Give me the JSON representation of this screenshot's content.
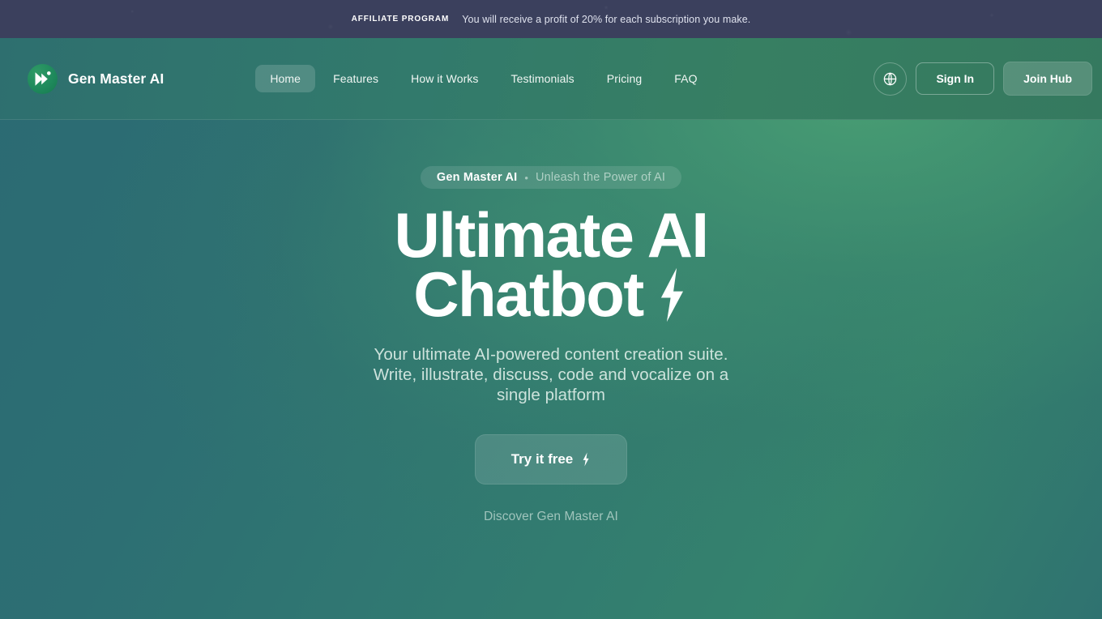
{
  "banner": {
    "tag": "AFFILIATE PROGRAM",
    "message": "You will receive a profit of 20% for each subscription you make.",
    "bg_color": "#3b405d"
  },
  "header": {
    "brand": {
      "name": "Gen Master AI",
      "logo_icon": "play-chevron-logo-icon",
      "logo_color": "#1f8a5c"
    },
    "nav": [
      {
        "label": "Home",
        "active": true
      },
      {
        "label": "Features",
        "active": false
      },
      {
        "label": "How it Works",
        "active": false
      },
      {
        "label": "Testimonials",
        "active": false
      },
      {
        "label": "Pricing",
        "active": false
      },
      {
        "label": "FAQ",
        "active": false
      }
    ],
    "actions": {
      "language_icon": "globe-icon",
      "sign_in_label": "Sign In",
      "join_hub_label": "Join Hub"
    }
  },
  "hero": {
    "badge": {
      "brand": "Gen Master AI",
      "separator": "•",
      "tagline": "Unleash the Power of AI"
    },
    "title_line1": "Ultimate AI",
    "title_line2": "Chatbot",
    "title_icon": "lightning-bolt-icon",
    "subtitle": "Your ultimate AI-powered content creation suite. Write, illustrate, discuss, code and vocalize on a single platform",
    "cta_label": "Try it free",
    "cta_icon": "lightning-bolt-icon",
    "discover_label": "Discover Gen Master AI"
  },
  "theme": {
    "accent_green": "#37836c",
    "teal": "#2c6d72",
    "header_green": "#35795f",
    "text_white": "#ffffff"
  }
}
